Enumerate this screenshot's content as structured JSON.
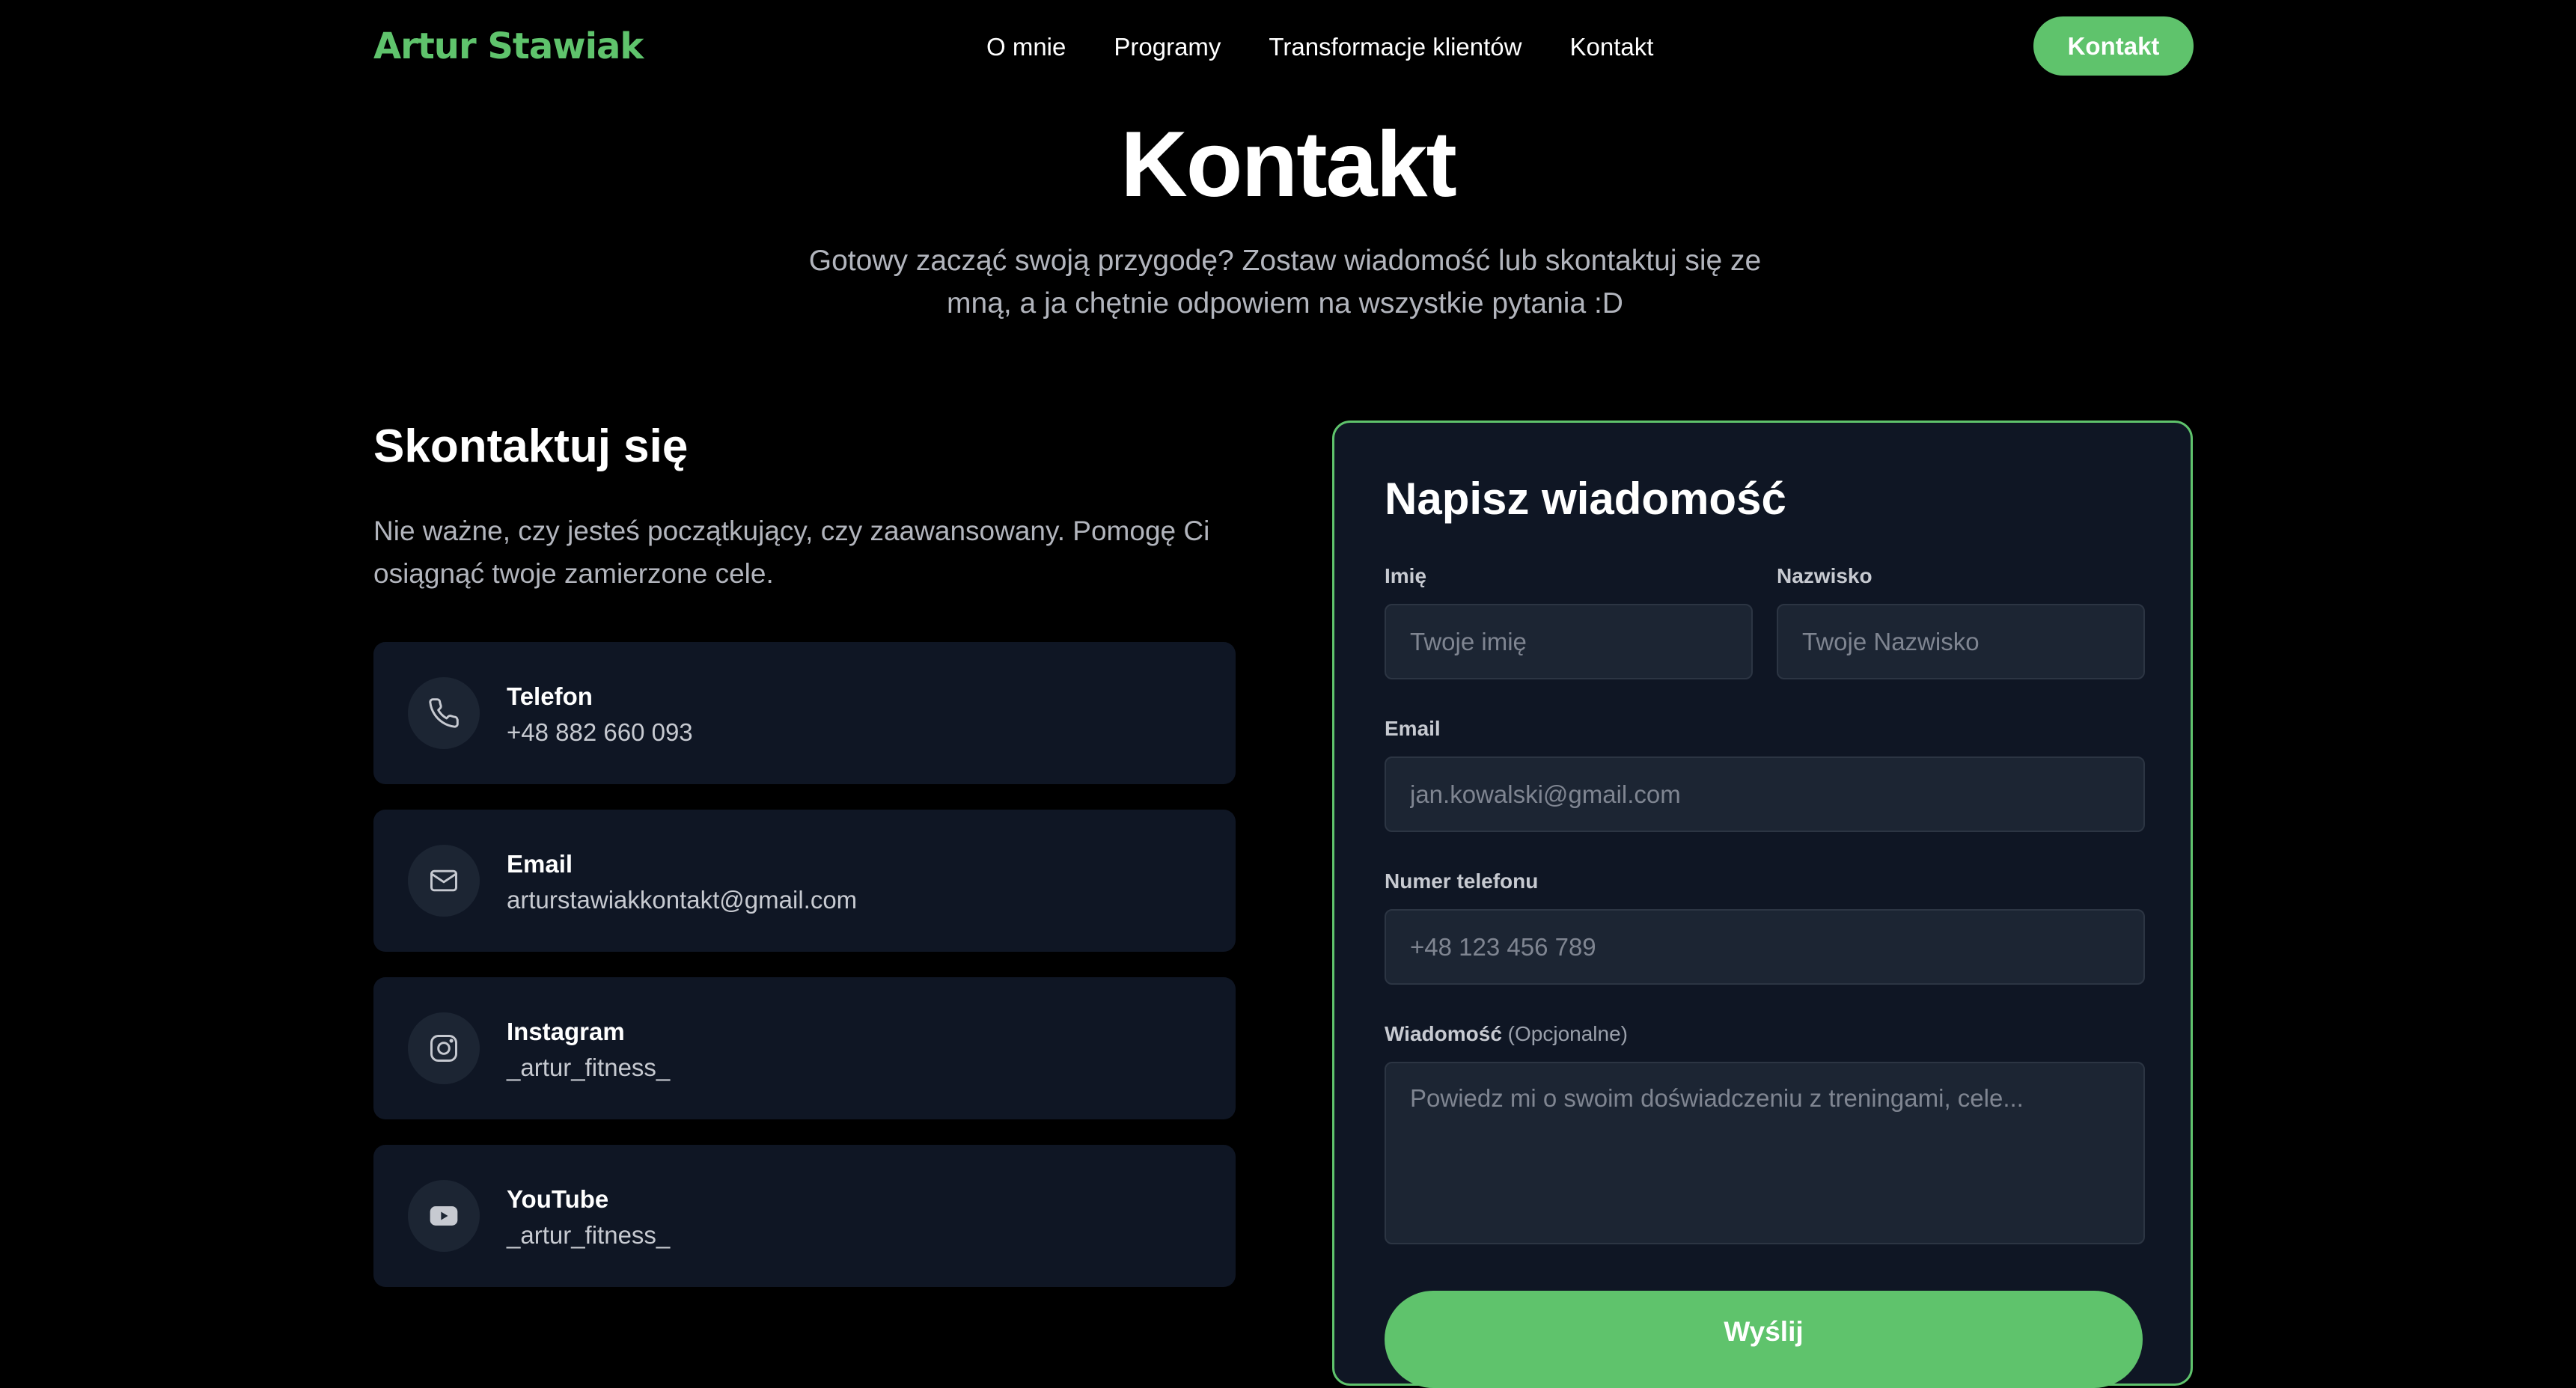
{
  "header": {
    "logo": "Artur Stawiak",
    "nav": [
      "O mnie",
      "Programy",
      "Transformacje klientów",
      "Kontakt"
    ],
    "cta_label": "Kontakt"
  },
  "hero": {
    "title": "Kontakt",
    "subtitle": "Gotowy zacząć swoją przygodę? Zostaw wiadomość lub skontaktuj się ze mną, a ja chętnie odpowiem na wszystkie pytania :D"
  },
  "contact": {
    "title": "Skontaktuj się",
    "description": "Nie ważne, czy jesteś początkujący, czy zaawansowany. Pomogę Ci osiągnąć twoje zamierzone cele.",
    "items": [
      {
        "label": "Telefon",
        "value": "+48 882 660 093",
        "icon": "phone-icon"
      },
      {
        "label": "Email",
        "value": "arturstawiakkontakt@gmail.com",
        "icon": "mail-icon"
      },
      {
        "label": "Instagram",
        "value": "_artur_fitness_",
        "icon": "instagram-icon"
      },
      {
        "label": "YouTube",
        "value": "_artur_fitness_",
        "icon": "youtube-icon"
      }
    ]
  },
  "form": {
    "title": "Napisz wiadomość",
    "first_name": {
      "label": "Imię",
      "placeholder": "Twoje imię",
      "value": ""
    },
    "last_name": {
      "label": "Nazwisko",
      "placeholder": "Twoje Nazwisko",
      "value": ""
    },
    "email": {
      "label": "Email",
      "placeholder": "jan.kowalski@gmail.com",
      "value": ""
    },
    "phone": {
      "label": "Numer telefonu",
      "placeholder": "+48 123 456 789",
      "value": ""
    },
    "message": {
      "label": "Wiadomość",
      "optional": "(Opcjonalne)",
      "placeholder": "Powiedz mi o swoim doświadczeniu z treningami, cele...",
      "value": ""
    },
    "submit_label": "Wyślij"
  },
  "colors": {
    "accent": "#5fc36c",
    "background": "#000000",
    "card": "#0f1624",
    "field": "#1c2533"
  }
}
